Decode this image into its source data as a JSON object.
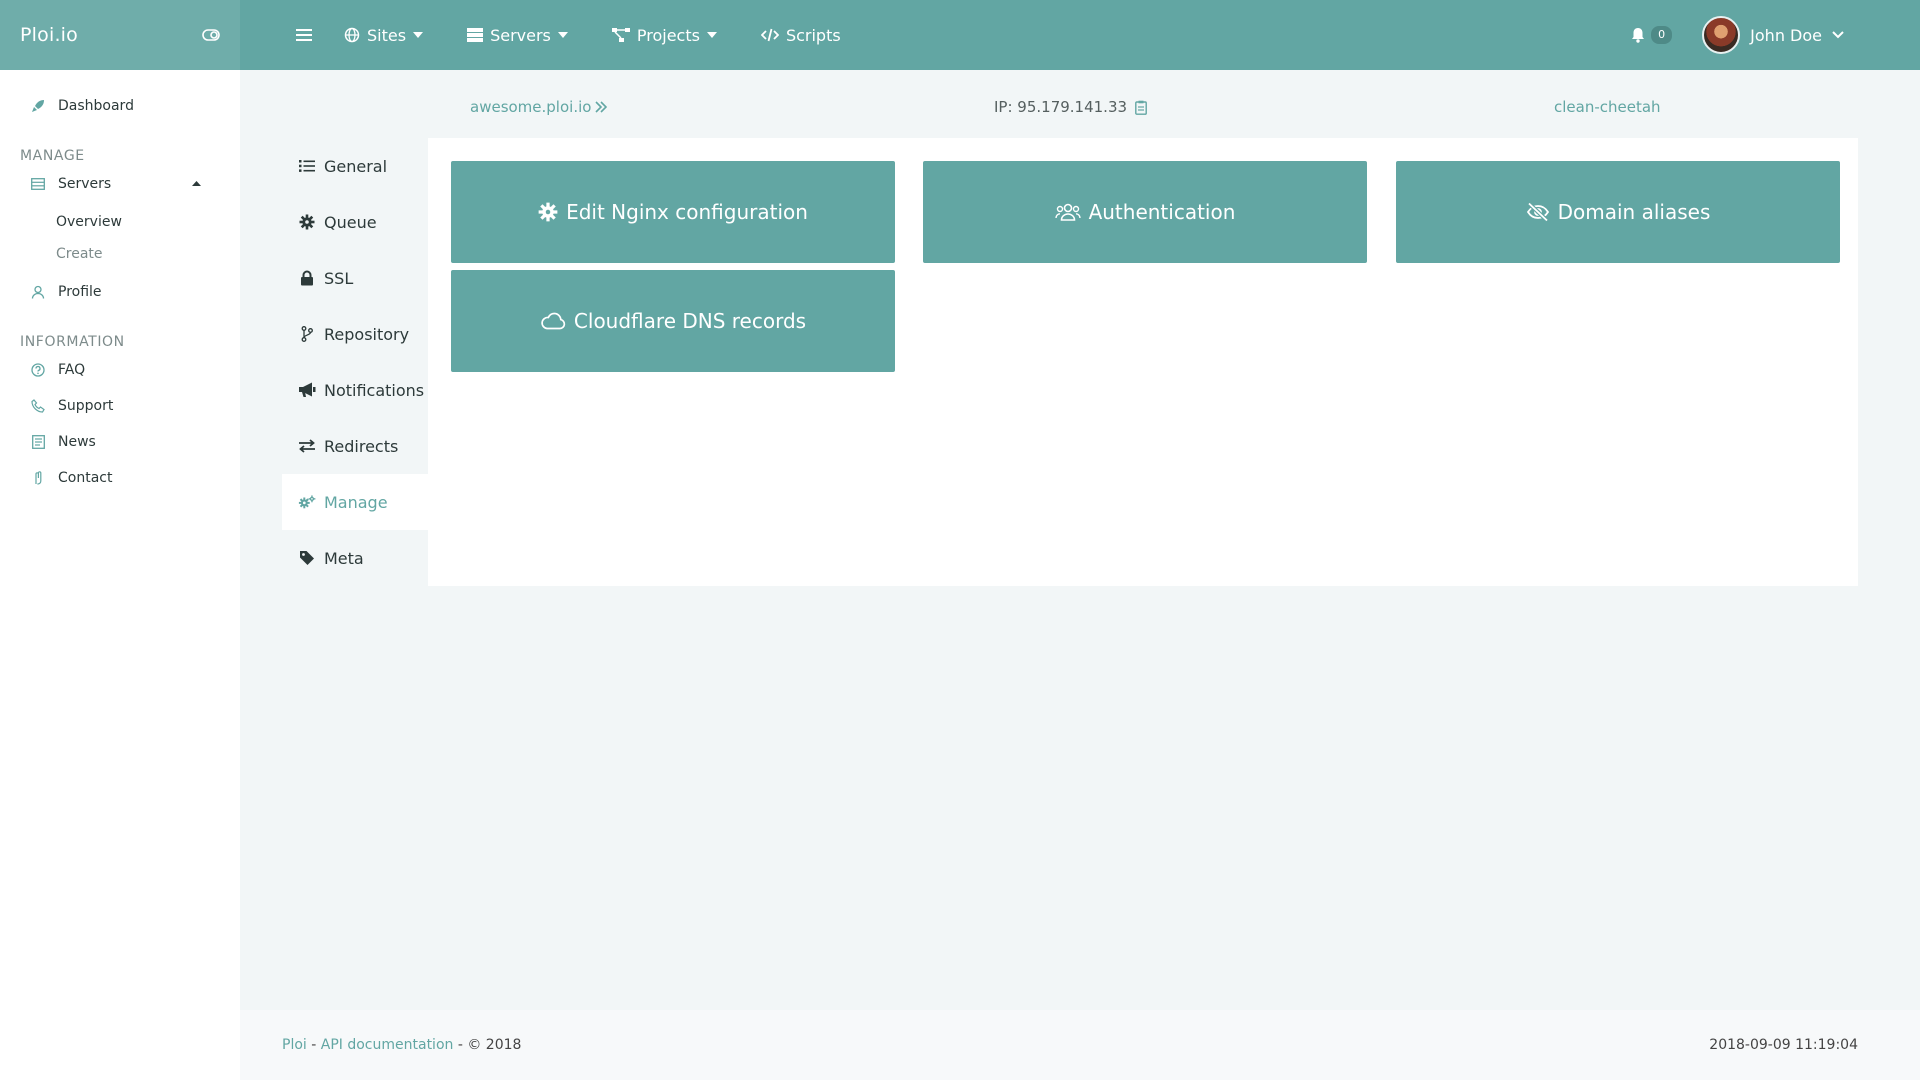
{
  "brand": {
    "name": "Ploi.io"
  },
  "topnav": {
    "sites": "Sites",
    "servers": "Servers",
    "projects": "Projects",
    "scripts": "Scripts",
    "notification_count": "0",
    "user_name": "John Doe"
  },
  "sidebar": {
    "dashboard": "Dashboard",
    "manage_title": "MANAGE",
    "servers": "Servers",
    "overview": "Overview",
    "create": "Create",
    "profile": "Profile",
    "information_title": "INFORMATION",
    "faq": "FAQ",
    "support": "Support",
    "news": "News",
    "contact": "Contact"
  },
  "site": {
    "domain": "awesome.ploi.io",
    "ip": "IP: 95.179.141.33",
    "server_name": "clean-cheetah"
  },
  "tabs": [
    {
      "label": "General"
    },
    {
      "label": "Queue"
    },
    {
      "label": "SSL"
    },
    {
      "label": "Repository"
    },
    {
      "label": "Notifications"
    },
    {
      "label": "Redirects"
    },
    {
      "label": "Manage"
    },
    {
      "label": "Meta"
    }
  ],
  "tiles": {
    "nginx": "Edit Nginx configuration",
    "auth": "Authentication",
    "aliases": "Domain aliases",
    "cloudflare": "Cloudflare DNS records"
  },
  "footer": {
    "ploi": "Ploi",
    "sep1": " - ",
    "api_docs": "API documentation",
    "copyright": " - © 2018",
    "timestamp": "2018-09-09 11:19:04"
  },
  "colors": {
    "accent": "#62a6a3",
    "brand_bg": "#6fadaa",
    "page_bg": "#f2f6f7"
  }
}
